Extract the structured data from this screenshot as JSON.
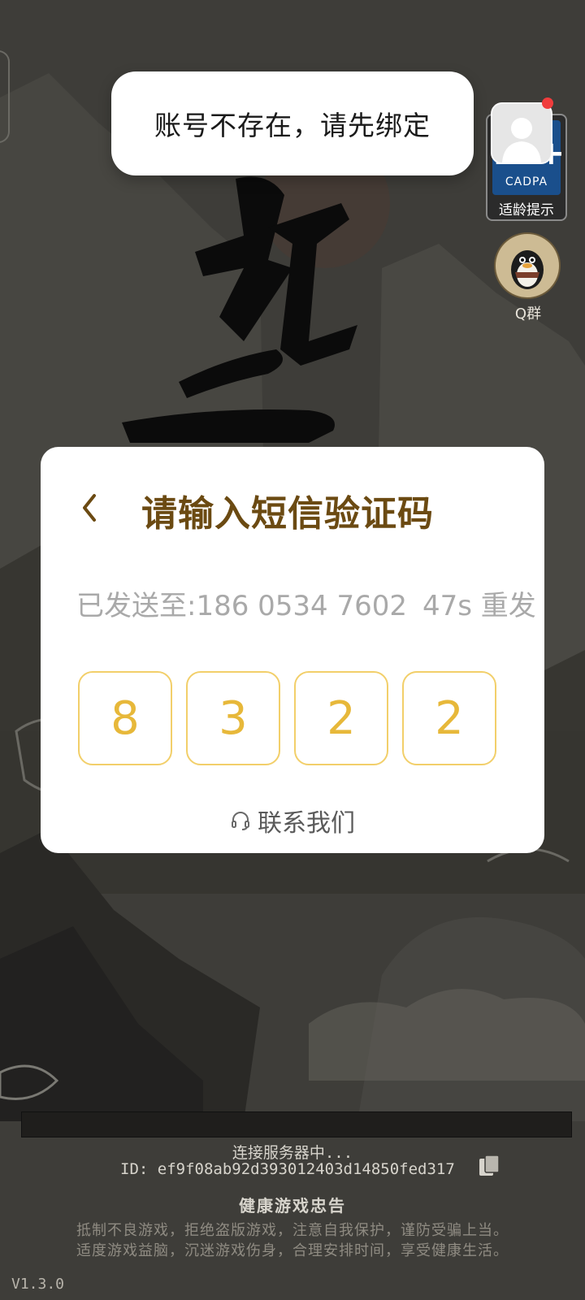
{
  "toast": {
    "message": "账号不存在，请先绑定"
  },
  "age_badge": {
    "rating": "12+",
    "org": "CADPA",
    "label": "适龄提示",
    "icon": "age-rating-icon"
  },
  "avatar": {
    "icon": "user-avatar-icon",
    "notification_dot": true
  },
  "qq_group": {
    "label": "Q群",
    "icon": "qq-penguin-icon"
  },
  "dialog": {
    "back_icon": "chevron-left-icon",
    "title": "请输入短信验证码",
    "sent_label": "已发送至:186 0534 7602",
    "resend_label": "47s 重发",
    "code_digits": [
      "8",
      "3",
      "2",
      "2"
    ],
    "contact_label": "联系我们",
    "contact_icon": "headset-icon"
  },
  "footer": {
    "status": "连接服务器中...",
    "id_text": "ID:  ef9f08ab92d393012403d14850fed317",
    "copy_icon": "copy-icon",
    "health_title": "健康游戏忠告",
    "health_lines": [
      "抵制不良游戏，拒绝盗版游戏，注意自我保护，谨防受骗上当。",
      "适度游戏益脑，沉迷游戏伤身，合理安排时间，享受健康生活。"
    ],
    "version": "V1.3.0"
  },
  "colors": {
    "background": "#3d3c38",
    "title_brown": "#6b4a12",
    "code_gold": "#e7b83a",
    "code_border": "#f2cf6a",
    "notification_red": "#f03c3c"
  }
}
